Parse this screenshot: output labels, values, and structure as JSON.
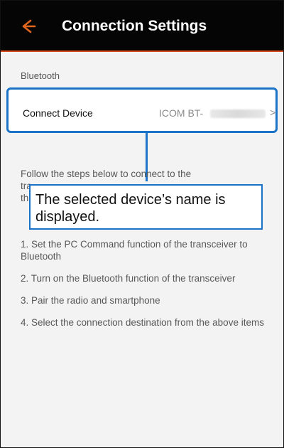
{
  "app": {
    "title": "Connection Settings",
    "back_icon": "arrow-left-icon"
  },
  "bluetooth": {
    "section_label": "Bluetooth",
    "connect_device_label": "Connect Device",
    "connect_device_value": "ICOM BT-",
    "chevron": ">"
  },
  "instructions": {
    "intro_line1": "Follow the steps below to connect to the",
    "intro_line2_left": "tra",
    "intro_line3_left": "th",
    "steps": [
      "1. Set the PC Command function of the transceiver to Bluetooth",
      "2. Turn on the Bluetooth function of the transceiver",
      "3. Pair the radio and smartphone",
      "4. Select the connection destination from the above items"
    ]
  },
  "callout": {
    "text": "The selected device’s name is displayed."
  },
  "colors": {
    "accent": "#1a73c7",
    "appbar_bg": "#050505",
    "back_arrow": "#e0661f"
  }
}
